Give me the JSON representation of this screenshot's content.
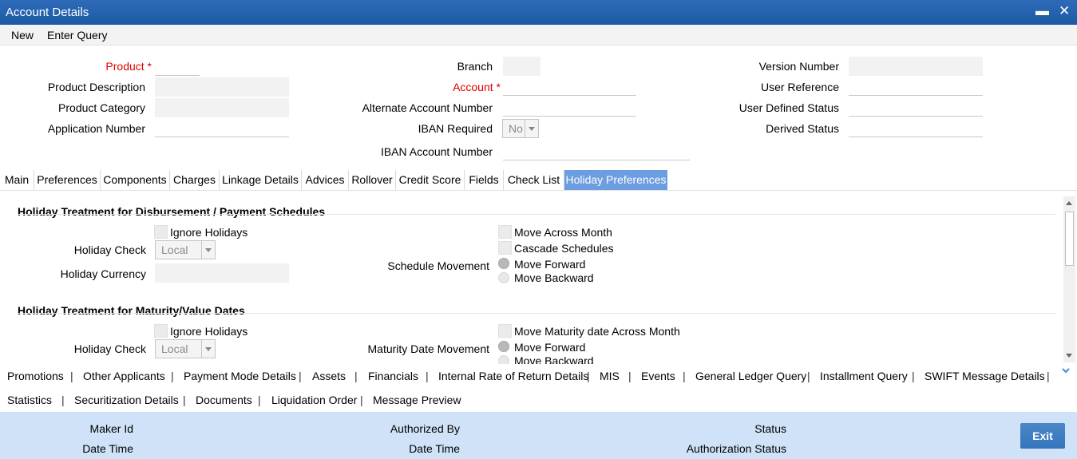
{
  "window": {
    "title": "Account Details",
    "minimize_icon": "minimize-icon",
    "close_icon": "close-icon"
  },
  "menu": {
    "new": "New",
    "enter_query": "Enter Query"
  },
  "header": {
    "product": {
      "label": "Product",
      "required": "*",
      "value": ""
    },
    "product_description": {
      "label": "Product Description",
      "value": ""
    },
    "product_category": {
      "label": "Product Category",
      "value": ""
    },
    "application_number": {
      "label": "Application Number",
      "value": ""
    },
    "branch": {
      "label": "Branch",
      "value": ""
    },
    "account": {
      "label": "Account",
      "required": "*",
      "value": ""
    },
    "alternate_account_number": {
      "label": "Alternate Account Number",
      "value": ""
    },
    "iban_required": {
      "label": "IBAN Required",
      "value": "No"
    },
    "iban_account_number": {
      "label": "IBAN Account Number",
      "value": ""
    },
    "version_number": {
      "label": "Version Number",
      "value": ""
    },
    "user_reference": {
      "label": "User Reference",
      "value": ""
    },
    "user_defined_status": {
      "label": "User Defined Status",
      "value": ""
    },
    "derived_status": {
      "label": "Derived Status",
      "value": ""
    }
  },
  "tabs": [
    "Main",
    "Preferences",
    "Components",
    "Charges",
    "Linkage Details",
    "Advices",
    "Rollover",
    "Credit Score",
    "Fields",
    "Check List",
    "Holiday Preferences"
  ],
  "active_tab": "Holiday Preferences",
  "disbursement": {
    "heading": "Holiday Treatment for Disbursement / Payment Schedules",
    "ignore_holidays": "Ignore Holidays",
    "holiday_check_label": "Holiday Check",
    "holiday_check_value": "Local",
    "holiday_currency_label": "Holiday Currency",
    "move_across_month": "Move Across Month",
    "cascade_schedules": "Cascade Schedules",
    "schedule_movement_label": "Schedule Movement",
    "move_forward": "Move Forward",
    "move_backward": "Move Backward",
    "selected_movement": "Move Forward"
  },
  "maturity": {
    "heading": "Holiday Treatment for Maturity/Value Dates",
    "ignore_holidays": "Ignore Holidays",
    "holiday_check_label": "Holiday Check",
    "holiday_check_value": "Local",
    "move_maturity_across_month": "Move Maturity date Across Month",
    "maturity_date_movement_label": "Maturity Date Movement",
    "move_forward": "Move Forward",
    "move_backward": "Move Backward",
    "selected_movement": "Move Forward"
  },
  "bottom_links_row1": [
    "Promotions",
    "Other Applicants",
    "Payment Mode Details",
    "Assets",
    "Financials",
    "Internal Rate of Return Details",
    "MIS",
    "Events",
    "General Ledger Query",
    "Installment Query",
    "SWIFT Message Details"
  ],
  "bottom_links_row2": [
    "Statistics",
    "Securitization Details",
    "Documents",
    "Liquidation Order",
    "Message Preview"
  ],
  "separator": "|",
  "footer": {
    "maker_id": "Maker Id",
    "date_time_1": "Date Time",
    "authorized_by": "Authorized By",
    "date_time_2": "Date Time",
    "status": "Status",
    "authorization_status": "Authorization Status",
    "exit": "Exit"
  },
  "colors": {
    "title_bar": "#1d5aa6",
    "active_tab": "#6c9de0",
    "required_label": "#e00000",
    "footer_bg": "#cfe2f7",
    "exit_button": "#3575bd"
  }
}
